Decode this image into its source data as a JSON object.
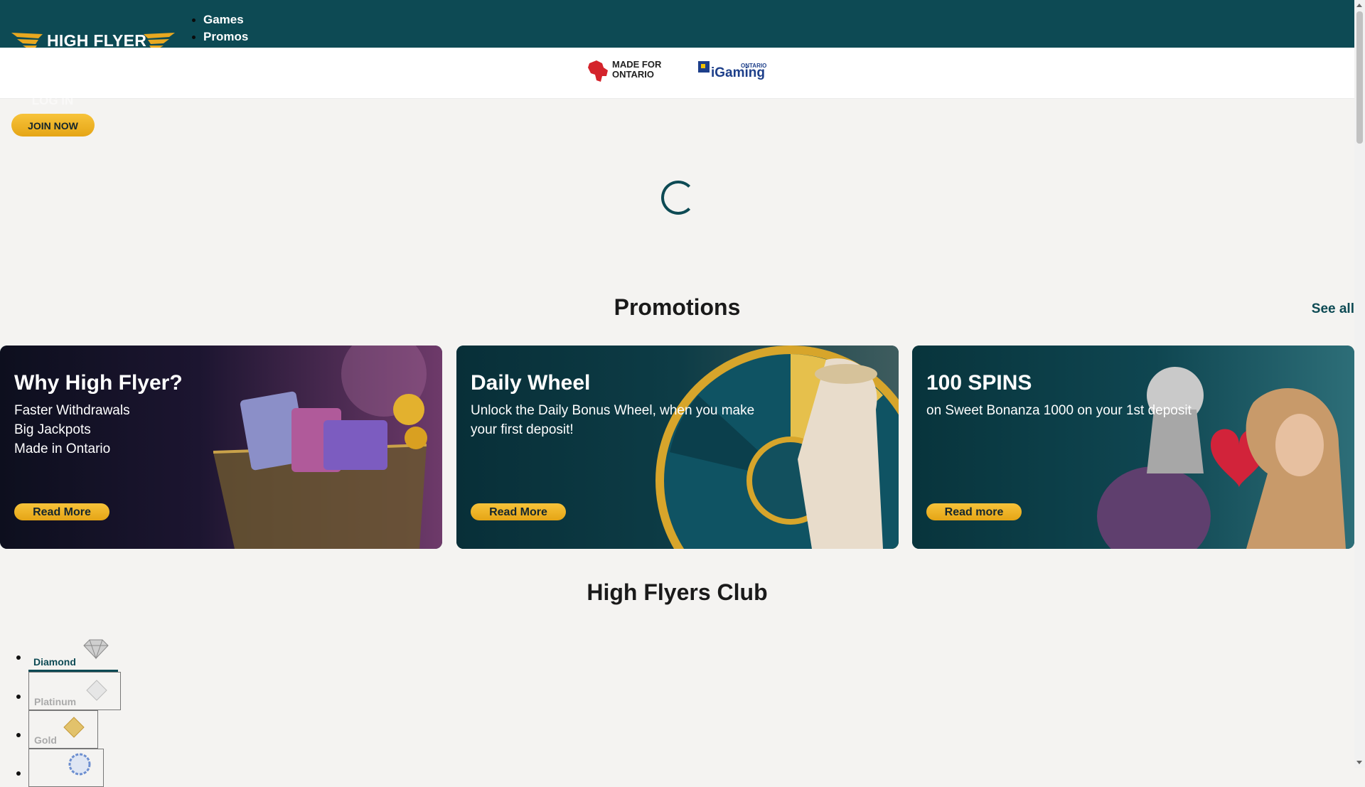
{
  "header": {
    "brand": "HIGH FLYER",
    "nav": [
      "Games",
      "Promos",
      "",
      ""
    ],
    "login_label": "LOG IN",
    "join_label": "JOIN NOW",
    "badges": {
      "ontario_line1": "MADE FOR",
      "ontario_line2": "ONTARIO",
      "igaming_small": "ONTARIO",
      "igaming_big": "iGaming"
    }
  },
  "colors": {
    "header_bg": "#0d4a54",
    "accent": "#f2b829",
    "page_bg": "#f4f3f1"
  },
  "promotions": {
    "title": "Promotions",
    "see_all": "See all",
    "cards": [
      {
        "title": "Why High Flyer?",
        "lines": [
          "Faster Withdrawals",
          "Big Jackpots",
          "Made in Ontario"
        ],
        "cta": "Read More"
      },
      {
        "title": "Daily Wheel",
        "lines": [
          "Unlock the Daily Bonus Wheel, when you make your first deposit!"
        ],
        "cta": "Read More"
      },
      {
        "title": "100 SPINS",
        "lines": [
          "on Sweet Bonanza 1000 on your 1st deposit"
        ],
        "cta": "Read more"
      }
    ]
  },
  "club": {
    "title": "High Flyers Club",
    "tiers": [
      {
        "label": "Diamond",
        "icon": "diamond-gem-icon"
      },
      {
        "label": "Platinum",
        "icon": "platinum-gem-icon"
      },
      {
        "label": "Gold",
        "icon": "gold-gem-icon"
      },
      {
        "label": "",
        "icon": "silver-badge-icon"
      }
    ]
  }
}
